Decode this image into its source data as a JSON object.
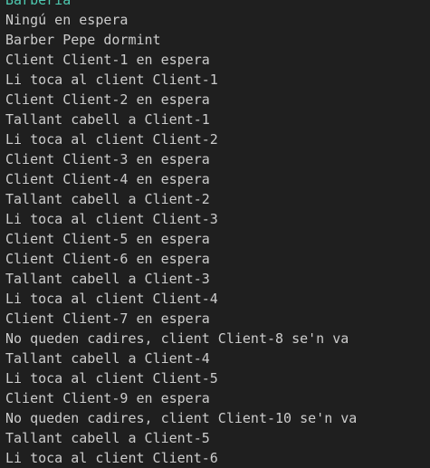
{
  "terminal": {
    "header": "Barberia",
    "lines": [
      "Ningú en espera",
      "Barber Pepe dormint",
      "Client Client-1 en espera",
      "Li toca al client Client-1",
      "Client Client-2 en espera",
      "Tallant cabell a Client-1",
      "Li toca al client Client-2",
      "Client Client-3 en espera",
      "Client Client-4 en espera",
      "Tallant cabell a Client-2",
      "Li toca al client Client-3",
      "Client Client-5 en espera",
      "Client Client-6 en espera",
      "Tallant cabell a Client-3",
      "Li toca al client Client-4",
      "Client Client-7 en espera",
      "No queden cadires, client Client-8 se'n va",
      "Tallant cabell a Client-4",
      "Li toca al client Client-5",
      "Client Client-9 en espera",
      "No queden cadires, client Client-10 se'n va",
      "Tallant cabell a Client-5",
      "Li toca al client Client-6"
    ]
  },
  "colors": {
    "background": "#1f1f1f",
    "text": "#cccccc",
    "header": "#4ec9b0"
  }
}
